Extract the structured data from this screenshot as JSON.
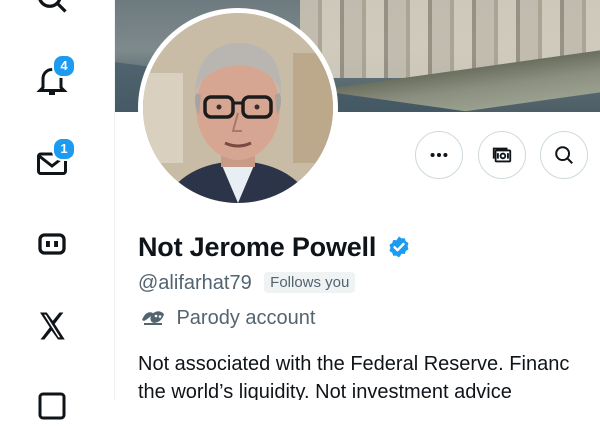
{
  "nav": {
    "items": [
      {
        "name": "search",
        "icon": "search-icon"
      },
      {
        "name": "notifications",
        "icon": "bell-icon",
        "badge": "4"
      },
      {
        "name": "messages",
        "icon": "envelope-icon",
        "badge": "1"
      },
      {
        "name": "grok",
        "icon": "grok-icon"
      },
      {
        "name": "x-premium",
        "icon": "x-logo-icon"
      },
      {
        "name": "more",
        "icon": "list-icon"
      }
    ]
  },
  "profile": {
    "display_name": "Not Jerome Powell",
    "verified": true,
    "handle": "@alifarhat79",
    "follows_you": "Follows you",
    "parody_label": "Parody account",
    "bio_line1": "Not associated with the Federal Reserve. Financ",
    "bio_line2": "the world’s liquidity. Not investment advice"
  },
  "actions": [
    {
      "name": "more-options-button",
      "icon": "ellipsis-icon"
    },
    {
      "name": "subscribe-button",
      "icon": "money-icon"
    },
    {
      "name": "search-profile-button",
      "icon": "search-icon"
    }
  ],
  "colors": {
    "accent": "#1d9bf0",
    "text_primary": "#0f1419",
    "text_secondary": "#536471",
    "border": "#cfd9de"
  }
}
